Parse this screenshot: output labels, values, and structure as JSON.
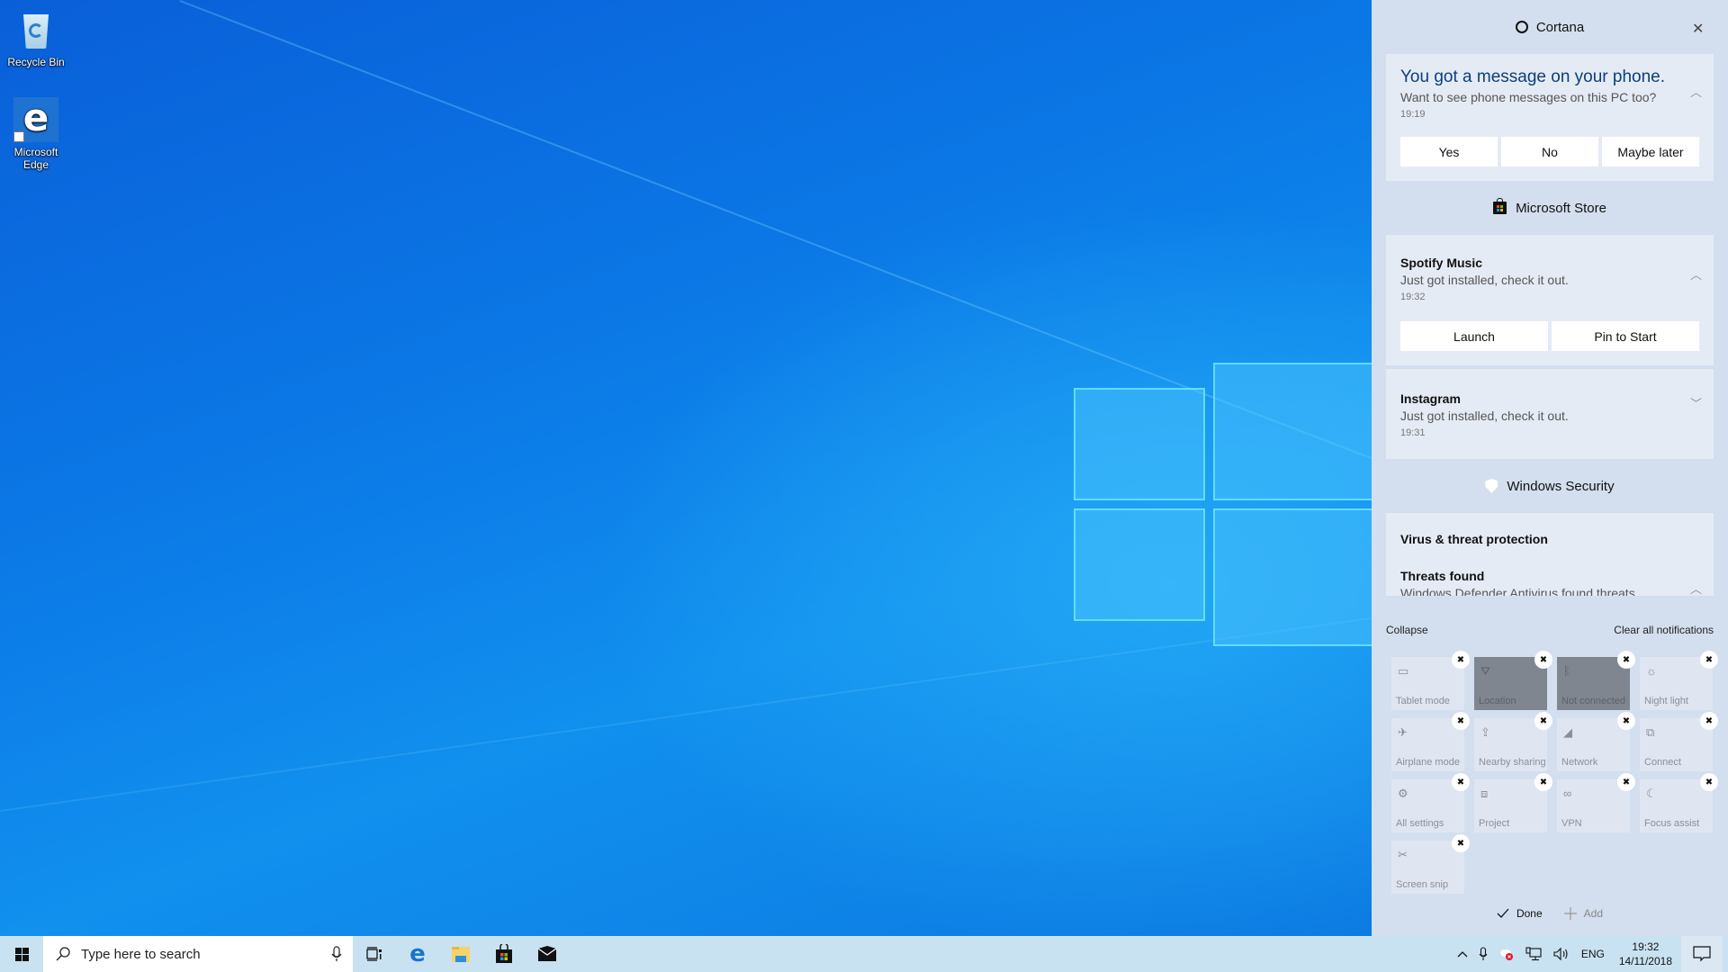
{
  "desktop": {
    "icons": [
      {
        "label": "Recycle Bin",
        "icon": "recycle-bin-icon"
      },
      {
        "label": "Microsoft\nEdge",
        "icon": "edge-icon"
      }
    ]
  },
  "taskbar": {
    "search_placeholder": "Type here to search",
    "pinned_apps": [
      "task-view",
      "microsoft-edge",
      "file-explorer",
      "microsoft-store",
      "mail"
    ],
    "tray": {
      "language": "ENG",
      "time": "19:32",
      "date": "14/11/2018"
    }
  },
  "action_center": {
    "groups": [
      {
        "app": "Cortana",
        "notifications": [
          {
            "title": "You got a message on your phone.",
            "body": "Want to see phone messages on this PC too?",
            "time": "19:19",
            "expanded": true,
            "buttons": [
              "Yes",
              "No",
              "Maybe later"
            ]
          }
        ]
      },
      {
        "app": "Microsoft Store",
        "notifications": [
          {
            "title": "Spotify Music",
            "body": "Just got installed, check it out.",
            "time": "19:32",
            "expanded": true,
            "buttons": [
              "Launch",
              "Pin to Start"
            ]
          },
          {
            "title": "Instagram",
            "body": "Just got installed, check it out.",
            "time": "19:31",
            "expanded": false
          }
        ]
      },
      {
        "app": "Windows Security",
        "notifications": [
          {
            "title": "Virus & threat protection",
            "subtitle": "Threats found",
            "body": "Windows Defender Antivirus found threats"
          }
        ]
      }
    ],
    "collapse_label": "Collapse",
    "clear_all_label": "Clear all notifications",
    "quick_actions": [
      {
        "label": "Tablet mode",
        "icon": "tablet-mode-icon",
        "glyph": "▭",
        "active": false
      },
      {
        "label": "Location",
        "icon": "location-icon",
        "glyph": "⛛",
        "active": true
      },
      {
        "label": "Not connected",
        "icon": "bluetooth-icon",
        "glyph": "ᛒ",
        "active": true
      },
      {
        "label": "Night light",
        "icon": "night-light-icon",
        "glyph": "☼",
        "active": false
      },
      {
        "label": "Airplane mode",
        "icon": "airplane-icon",
        "glyph": "✈",
        "active": false
      },
      {
        "label": "Nearby sharing",
        "icon": "nearby-sharing-icon",
        "glyph": "⇪",
        "active": false
      },
      {
        "label": "Network",
        "icon": "network-icon",
        "glyph": "◢",
        "active": false
      },
      {
        "label": "Connect",
        "icon": "connect-icon",
        "glyph": "⧉",
        "active": false
      },
      {
        "label": "All settings",
        "icon": "gear-icon",
        "glyph": "⚙",
        "active": false
      },
      {
        "label": "Project",
        "icon": "project-icon",
        "glyph": "⧈",
        "active": false
      },
      {
        "label": "VPN",
        "icon": "vpn-icon",
        "glyph": "∞",
        "active": false
      },
      {
        "label": "Focus assist",
        "icon": "moon-icon",
        "glyph": "☾",
        "active": false
      },
      {
        "label": "Screen snip",
        "icon": "screen-snip-icon",
        "glyph": "✂",
        "active": false
      }
    ],
    "done_label": "Done",
    "add_label": "Add"
  }
}
